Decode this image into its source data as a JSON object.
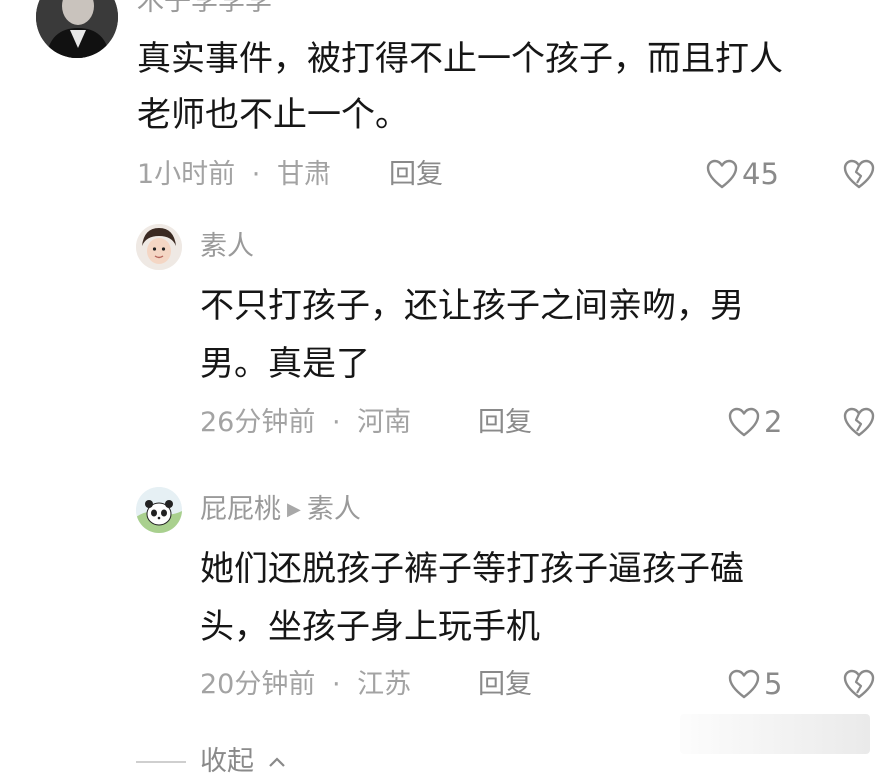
{
  "comments": [
    {
      "username": "木子李李李",
      "text_line1": "真实事件，被打得不止一个孩子，而且打人",
      "text_line2": "老师也不止一个。",
      "time": "1小时前",
      "separator": "·",
      "location": "甘肃",
      "reply_label": "回复",
      "likes": "45"
    },
    {
      "username": "素人",
      "text_line1": "不只打孩子，还让孩子之间亲吻，男",
      "text_line2": "男。真是了",
      "time": "26分钟前",
      "separator": "·",
      "location": "河南",
      "reply_label": "回复",
      "likes": "2"
    },
    {
      "username": "屁屁桃",
      "reply_to": "素人",
      "text_line1": "她们还脱孩子裤子等打孩子逼孩子磕",
      "text_line2": "头，坐孩子身上玩手机",
      "time": "20分钟前",
      "separator": "·",
      "location": "江苏",
      "reply_label": "回复",
      "likes": "5"
    }
  ],
  "collapse_label": "收起",
  "icons": {
    "like": "heart-outline-icon",
    "dislike": "broken-heart-icon",
    "reply_arrow": "triangle-right-icon",
    "collapse": "chevron-up-icon"
  },
  "colors": {
    "text": "#161616",
    "meta": "#a3a3a3",
    "icon": "#8a8a8a"
  }
}
